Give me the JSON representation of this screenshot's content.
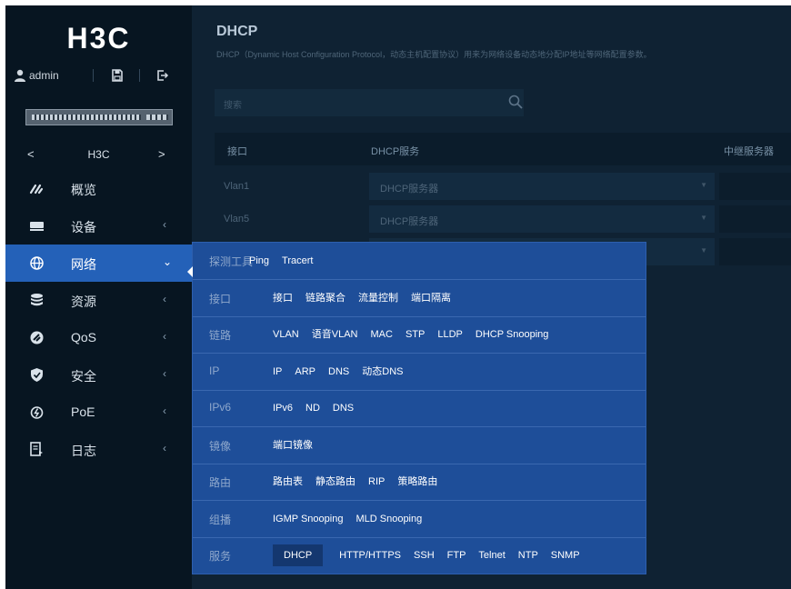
{
  "sidebar": {
    "logo": "H3C",
    "user": "admin",
    "device_name": "H3C",
    "device_prev": "<",
    "device_next": ">",
    "menu": [
      {
        "label": "概览",
        "chevron": ""
      },
      {
        "label": "设备",
        "chevron": "‹"
      },
      {
        "label": "网络",
        "chevron": "⌄"
      },
      {
        "label": "资源",
        "chevron": "‹"
      },
      {
        "label": "QoS",
        "chevron": "‹"
      },
      {
        "label": "安全",
        "chevron": "‹"
      },
      {
        "label": "PoE",
        "chevron": "‹"
      },
      {
        "label": "日志",
        "chevron": "‹"
      }
    ]
  },
  "main": {
    "title": "DHCP",
    "description": "DHCP（Dynamic Host Configuration Protocol，动态主机配置协议）用来为网络设备动态地分配IP地址等网络配置参数。",
    "search_placeholder": "搜索",
    "table": {
      "headers": [
        "接口",
        "DHCP服务",
        "中继服务器"
      ],
      "rows": [
        {
          "interface": "Vlan1",
          "service": "DHCP服务器"
        },
        {
          "interface": "Vlan5",
          "service": "DHCP服务器"
        },
        {
          "interface": "",
          "service": ""
        }
      ]
    }
  },
  "flyout": {
    "rows": [
      {
        "category": "探测工具",
        "items": [
          "Ping",
          "Tracert"
        ]
      },
      {
        "category": "接口",
        "items": [
          "接口",
          "链路聚合",
          "流量控制",
          "端口隔离"
        ]
      },
      {
        "category": "链路",
        "items": [
          "VLAN",
          "语音VLAN",
          "MAC",
          "STP",
          "LLDP",
          "DHCP Snooping"
        ]
      },
      {
        "category": "IP",
        "items": [
          "IP",
          "ARP",
          "DNS",
          "动态DNS"
        ]
      },
      {
        "category": "IPv6",
        "items": [
          "IPv6",
          "ND",
          "DNS"
        ]
      },
      {
        "category": "镜像",
        "items": [
          "端口镜像"
        ]
      },
      {
        "category": "路由",
        "items": [
          "路由表",
          "静态路由",
          "RIP",
          "策略路由"
        ]
      },
      {
        "category": "组播",
        "items": [
          "IGMP Snooping",
          "MLD Snooping"
        ]
      },
      {
        "category": "服务",
        "items": [
          "DHCP",
          "HTTP/HTTPS",
          "SSH",
          "FTP",
          "Telnet",
          "NTP",
          "SNMP"
        ],
        "selected": "DHCP"
      }
    ]
  },
  "colors": {
    "sidebar_bg": "#071521",
    "main_bg": "#0f2233",
    "active_menu": "#2461b8",
    "flyout_bg": "#1e4e99"
  }
}
